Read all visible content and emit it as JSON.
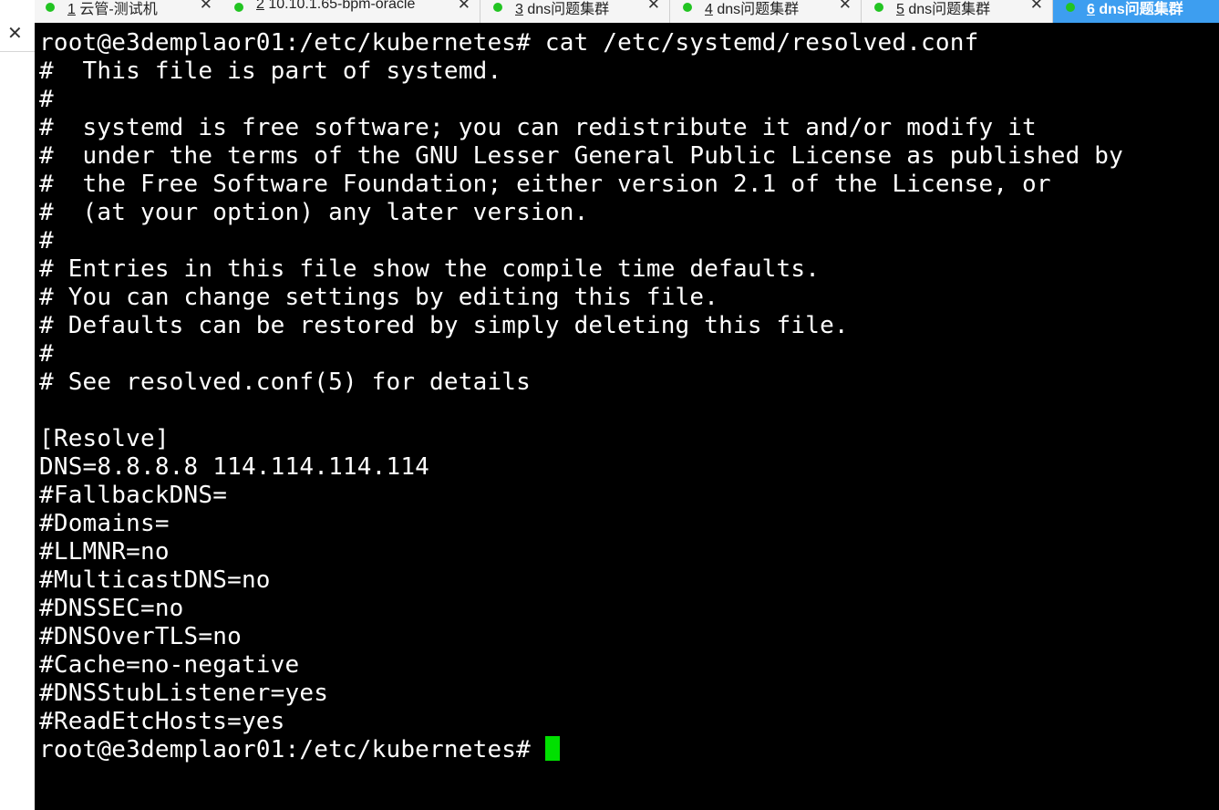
{
  "window": {
    "close_glyph": "✕",
    "chevron_glyph": "˄"
  },
  "tabs": [
    {
      "number": "1",
      "title": "云管-测试机",
      "status_color": "#22c422",
      "active": false
    },
    {
      "number": "2",
      "title": "10.10.1.65-bpm-oracle",
      "status_color": "#22c422",
      "active": false
    },
    {
      "number": "3",
      "title": "dns问题集群",
      "status_color": "#22c422",
      "active": false
    },
    {
      "number": "4",
      "title": "dns问题集群",
      "status_color": "#22c422",
      "active": false
    },
    {
      "number": "5",
      "title": "dns问题集群",
      "status_color": "#22c422",
      "active": false
    },
    {
      "number": "6",
      "title": "dns问题集群",
      "status_color": "#22c422",
      "active": true
    }
  ],
  "tab_close_glyph": "✕",
  "accent_color": "#3d9ef0",
  "terminal": {
    "lines": [
      "root@e3demplaor01:/etc/kubernetes# cat /etc/systemd/resolved.conf",
      "#  This file is part of systemd.",
      "#",
      "#  systemd is free software; you can redistribute it and/or modify it",
      "#  under the terms of the GNU Lesser General Public License as published by",
      "#  the Free Software Foundation; either version 2.1 of the License, or",
      "#  (at your option) any later version.",
      "#",
      "# Entries in this file show the compile time defaults.",
      "# You can change settings by editing this file.",
      "# Defaults can be restored by simply deleting this file.",
      "#",
      "# See resolved.conf(5) for details",
      "",
      "[Resolve]",
      "DNS=8.8.8.8 114.114.114.114",
      "#FallbackDNS=",
      "#Domains=",
      "#LLMNR=no",
      "#MulticastDNS=no",
      "#DNSSEC=no",
      "#DNSOverTLS=no",
      "#Cache=no-negative",
      "#DNSStubListener=yes",
      "#ReadEtcHosts=yes"
    ],
    "prompt": "root@e3demplaor01:/etc/kubernetes# ",
    "cursor_color": "#00e000"
  }
}
